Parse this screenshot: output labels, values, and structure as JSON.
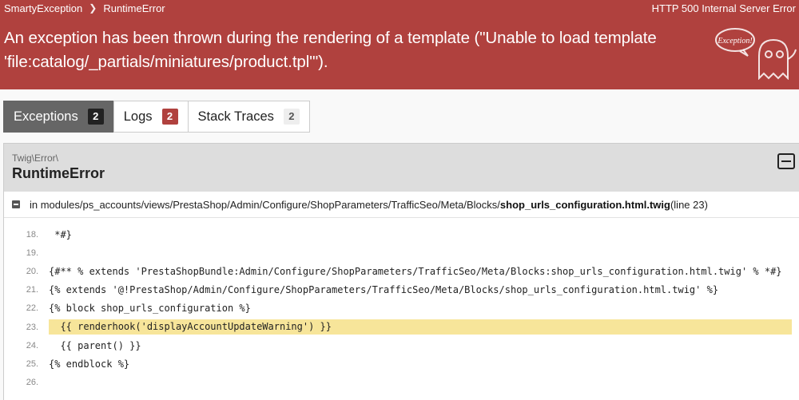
{
  "breadcrumb": {
    "root": "SmartyException",
    "separator": "❯",
    "current": "RuntimeError"
  },
  "status": "HTTP 500 Internal Server Error",
  "headline": "An exception has been thrown during the rendering of a template (\"Unable to load template 'file:catalog/_partials/miniatures/product.tpl'\").",
  "ghost_text": "Exception!",
  "tabs": [
    {
      "label": "Exceptions",
      "count": "2"
    },
    {
      "label": "Logs",
      "count": "2"
    },
    {
      "label": "Stack Traces",
      "count": "2"
    }
  ],
  "exception": {
    "namespace": "Twig\\Error\\",
    "class": "RuntimeError",
    "file_prefix": "in modules/ps_accounts/views/PrestaShop/Admin/Configure/ShopParameters/TrafficSeo/Meta/Blocks/",
    "file_name": "shop_urls_configuration.html.twig",
    "file_suffix": " (line 23)"
  },
  "code_lines": [
    {
      "num": "18.",
      "text": " *#}"
    },
    {
      "num": "19.",
      "text": ""
    },
    {
      "num": "20.",
      "text": "{#** % extends 'PrestaShopBundle:Admin/Configure/ShopParameters/TrafficSeo/Meta/Blocks:shop_urls_configuration.html.twig' % *#}"
    },
    {
      "num": "21.",
      "text": "{% extends '@!PrestaShop/Admin/Configure/ShopParameters/TrafficSeo/Meta/Blocks/shop_urls_configuration.html.twig' %}"
    },
    {
      "num": "22.",
      "text": "{% block shop_urls_configuration %}"
    },
    {
      "num": "23.",
      "text": "  {{ renderhook('displayAccountUpdateWarning') }}"
    },
    {
      "num": "24.",
      "text": "  {{ parent() }}"
    },
    {
      "num": "25.",
      "text": "{% endblock %}"
    },
    {
      "num": "26.",
      "text": ""
    }
  ],
  "highlight_line": "23.",
  "colors": {
    "header": "#b0413e",
    "highlight": "#f7e59a",
    "active_tab": "#666666"
  }
}
